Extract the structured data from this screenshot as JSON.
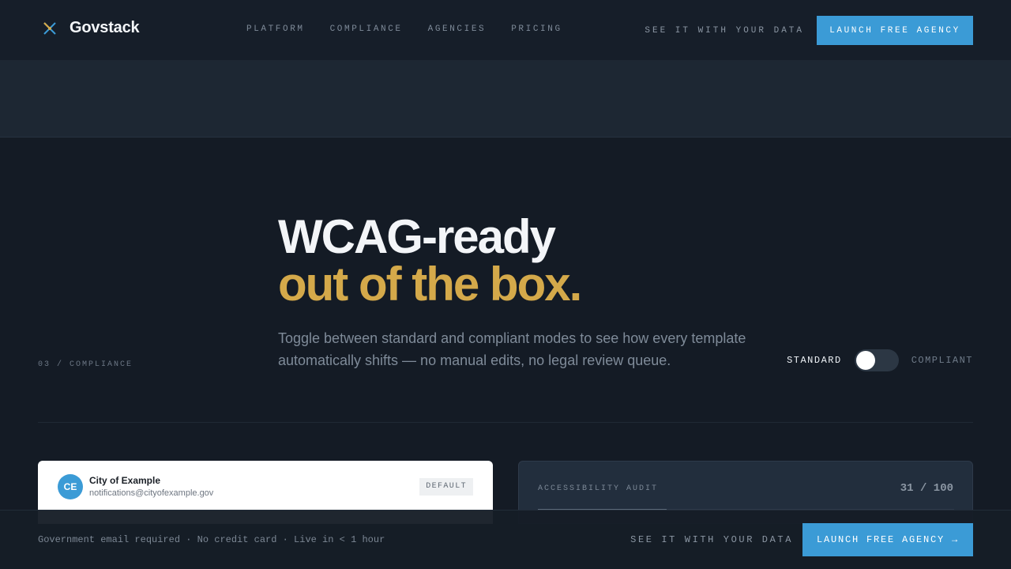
{
  "header": {
    "brand": "Govstack",
    "nav": [
      {
        "label": "PLATFORM"
      },
      {
        "label": "COMPLIANCE"
      },
      {
        "label": "AGENCIES"
      },
      {
        "label": "PRICING"
      }
    ],
    "see_link": "SEE IT WITH YOUR DATA",
    "cta": "LAUNCH FREE AGENCY"
  },
  "hero": {
    "title_line1": "WCAG-ready",
    "title_line2": "out of the box.",
    "subtitle": "Toggle between standard and compliant modes to see how every template automatically shifts — no manual edits, no legal review queue.",
    "section_label": "03 / COMPLIANCE"
  },
  "toggle": {
    "left_label": "STANDARD",
    "right_label": "COMPLIANT",
    "state": "standard"
  },
  "email_card": {
    "avatar_initials": "CE",
    "sender_name": "City of Example",
    "sender_email": "notifications@cityofexample.gov",
    "badge": "DEFAULT"
  },
  "audit_card": {
    "label": "ACCESSIBILITY AUDIT",
    "score_text": "31 / 100",
    "score": 31,
    "max": 100
  },
  "footer": {
    "note": "Government email required · No credit card · Live in < 1 hour",
    "see_link": "SEE IT WITH YOUR DATA",
    "cta": "LAUNCH FREE AGENCY →"
  },
  "colors": {
    "accent": "#3b9bd6",
    "gold": "#d4a94a",
    "background": "#141b25"
  },
  "icons": {
    "brand": "spark-cross-icon"
  }
}
